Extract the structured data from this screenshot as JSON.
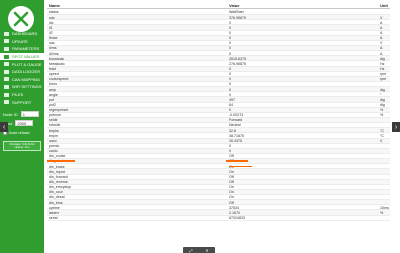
{
  "sidebar": {
    "nav": [
      {
        "label": "DASHBOARD",
        "icon": "dashboard-icon",
        "active": false
      },
      {
        "label": "UPDATE",
        "icon": "update-icon",
        "active": false
      },
      {
        "label": "PARAMETERS",
        "icon": "parameters-icon",
        "active": false
      },
      {
        "label": "SPOT VALUES",
        "icon": "spot-values-icon",
        "active": true
      },
      {
        "label": "PLOT & GAUGE",
        "icon": "plot-icon",
        "active": false
      },
      {
        "label": "DATA LOGGER",
        "icon": "logger-icon",
        "active": false
      },
      {
        "label": "CAN MAPPING",
        "icon": "can-icon",
        "active": false
      },
      {
        "label": "WIFI SETTINGS",
        "icon": "wifi-icon",
        "active": false
      },
      {
        "label": "FILES",
        "icon": "files-icon",
        "active": false
      },
      {
        "label": "SUPPORT",
        "icon": "support-icon",
        "active": false
      }
    ],
    "node_label": "Node ID",
    "node_value": "1",
    "baud_label": "Baud",
    "baud_value": "2000",
    "auto_reload_label": "Auto reload",
    "status_line1": "Firmware: 5.24.R-foc",
    "status_line2": "Uptime: 16 s"
  },
  "table": {
    "headers": {
      "name": "Name",
      "value": "Value",
      "unit": "Unit"
    },
    "rows": [
      {
        "name": "status",
        "value": "WaitStart",
        "unit": ""
      },
      {
        "name": "udc",
        "value": "376.95675",
        "unit": "V"
      },
      {
        "name": "idc",
        "value": "0",
        "unit": "A"
      },
      {
        "name": "il1",
        "value": "0",
        "unit": "A"
      },
      {
        "name": "il2",
        "value": "0",
        "unit": "A"
      },
      {
        "name": "ilmax",
        "value": "0",
        "unit": "A"
      },
      {
        "name": "uac",
        "value": "0",
        "unit": "V"
      },
      {
        "name": "ilrms",
        "value": "0",
        "unit": "A"
      },
      {
        "name": "il2rms",
        "value": "0",
        "unit": "A"
      },
      {
        "name": "boostcalc",
        "value": "2615.6375",
        "unit": "dig"
      },
      {
        "name": "fweakcalc",
        "value": "276.96875",
        "unit": "Hz"
      },
      {
        "name": "fstat",
        "value": "0",
        "unit": "Hz"
      },
      {
        "name": "speed",
        "value": "0",
        "unit": "rpm"
      },
      {
        "name": "cruisespeed",
        "value": "0",
        "unit": "rpm"
      },
      {
        "name": "turns",
        "value": "0",
        "unit": ""
      },
      {
        "name": "amp",
        "value": "0",
        "unit": "dig"
      },
      {
        "name": "angle",
        "value": "0",
        "unit": "°"
      },
      {
        "name": "pot",
        "value": "497",
        "unit": "dig"
      },
      {
        "name": "pot2",
        "value": "64",
        "unit": "dig"
      },
      {
        "name": "regenpreset",
        "value": "0",
        "unit": "%"
      },
      {
        "name": "potnom",
        "value": "-0.00273",
        "unit": "%"
      },
      {
        "name": "seldir",
        "value": "Forward",
        "unit": ""
      },
      {
        "name": "rotordir",
        "value": "Neutral",
        "unit": ""
      },
      {
        "name": "tmphs",
        "value": "32.6",
        "unit": "°C"
      },
      {
        "name": "tmpm",
        "value": "38.71875",
        "unit": "°C"
      },
      {
        "name": "uaux",
        "value": "26.4375",
        "unit": "V"
      },
      {
        "name": "pwmio",
        "value": "0",
        "unit": ""
      },
      {
        "name": "canio",
        "value": "0",
        "unit": ""
      },
      {
        "name": "din_cruise",
        "value": "Off",
        "unit": ""
      },
      {
        "name": "din_start",
        "value": "Off",
        "unit": ""
      },
      {
        "name": "din_brake",
        "value": "On",
        "unit": ""
      },
      {
        "name": "din_mprot",
        "value": "On",
        "unit": ""
      },
      {
        "name": "din_forward",
        "value": "Off",
        "unit": ""
      },
      {
        "name": "din_reverse",
        "value": "Off",
        "unit": ""
      },
      {
        "name": "din_emcystop",
        "value": "On",
        "unit": ""
      },
      {
        "name": "din_ocur",
        "value": "On",
        "unit": ""
      },
      {
        "name": "din_desat",
        "value": "On",
        "unit": ""
      },
      {
        "name": "din_bms",
        "value": "Off",
        "unit": ""
      },
      {
        "name": "uptime",
        "value": "37534",
        "unit": "10ms"
      },
      {
        "name": "lasterr",
        "value": "2.1670",
        "unit": "%"
      },
      {
        "name": "serial",
        "value": "67024833",
        "unit": ""
      }
    ]
  },
  "icons": {
    "logo": "x-logo-icon",
    "prev": "chevron-left-icon",
    "next": "chevron-right-icon",
    "expand": "expand-icon",
    "close": "close-icon"
  },
  "colors": {
    "accent": "#2f9e2f",
    "highlight": "#ff6a00"
  }
}
